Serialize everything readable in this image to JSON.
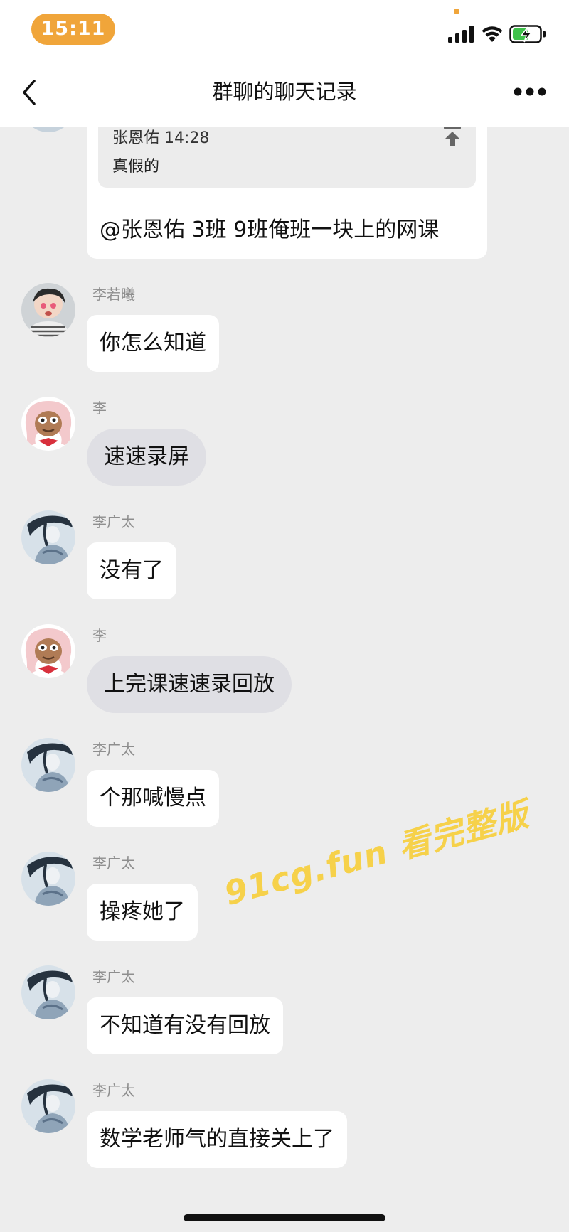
{
  "status_bar": {
    "time": "15:11"
  },
  "nav": {
    "title": "群聊的聊天记录",
    "back_icon": "chevron-left-icon",
    "more_icon": "more-horizontal-icon"
  },
  "quoted_message": {
    "author": "张恩佑 14:28",
    "text": "真假的",
    "reply": "@张恩佑 3班 9班俺班一块上的网课"
  },
  "messages": [
    {
      "sender": "李若曦",
      "text": "你怎么知道"
    },
    {
      "sender": "李",
      "text": "速速录屏"
    },
    {
      "sender": "李广太",
      "text": "没有了"
    },
    {
      "sender": "李",
      "text": "上完课速速录回放"
    },
    {
      "sender": "李广太",
      "text": "个那喊慢点"
    },
    {
      "sender": "李广太",
      "text": "操疼她了"
    },
    {
      "sender": "李广太",
      "text": "不知道有没有回放"
    },
    {
      "sender": "李广太",
      "text": "数学老师气的直接关上了"
    }
  ],
  "watermark": "91cg.fun 看完整版",
  "colors": {
    "time_pill": "#f0a53a",
    "chat_background": "#ededed",
    "bubble_white": "#ffffff",
    "bubble_gray": "#dfdfe4",
    "watermark": "#f6ce3c"
  }
}
